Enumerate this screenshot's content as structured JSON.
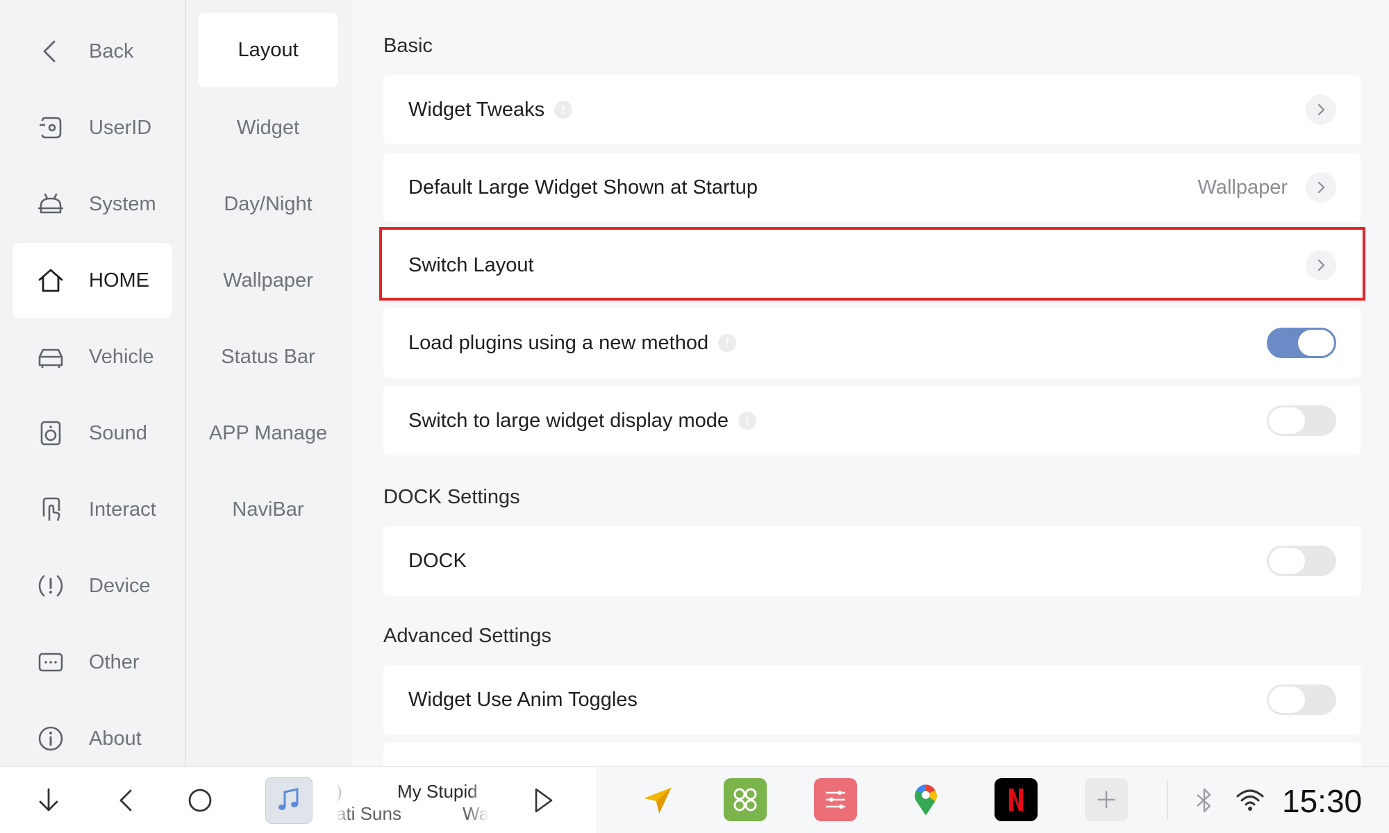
{
  "nav": {
    "items": [
      {
        "label": "Back",
        "icon": "chevron-left-icon"
      },
      {
        "label": "UserID",
        "icon": "user-id-icon"
      },
      {
        "label": "System",
        "icon": "android-icon"
      },
      {
        "label": "HOME",
        "icon": "home-icon",
        "active": true
      },
      {
        "label": "Vehicle",
        "icon": "car-icon"
      },
      {
        "label": "Sound",
        "icon": "speaker-icon"
      },
      {
        "label": "Interact",
        "icon": "touch-icon"
      },
      {
        "label": "Device",
        "icon": "alert-icon"
      },
      {
        "label": "Other",
        "icon": "more-icon"
      },
      {
        "label": "About",
        "icon": "info-icon"
      }
    ]
  },
  "subnav": {
    "items": [
      {
        "label": "Layout",
        "active": true
      },
      {
        "label": "Widget"
      },
      {
        "label": "Day/Night"
      },
      {
        "label": "Wallpaper"
      },
      {
        "label": "Status Bar"
      },
      {
        "label": "APP Manage"
      },
      {
        "label": "NaviBar"
      }
    ]
  },
  "content": {
    "basic_title": "Basic",
    "rows": {
      "widget_tweaks": {
        "label": "Widget Tweaks",
        "info": "!"
      },
      "default_large_widget": {
        "label": "Default Large Widget Shown at Startup",
        "value": "Wallpaper"
      },
      "switch_layout": {
        "label": "Switch Layout"
      },
      "load_plugins": {
        "label": "Load plugins using a new method",
        "info": "!",
        "toggle": true
      },
      "large_widget_mode": {
        "label": "Switch to large widget display mode",
        "info": "!",
        "toggle": false
      }
    },
    "dock_title": "DOCK Settings",
    "dock_row": {
      "label": "DOCK",
      "toggle": false
    },
    "advanced_title": "Advanced Settings",
    "anim_row": {
      "label": "Widget Use Anim Toggles",
      "toggle": false
    }
  },
  "bottombar": {
    "media": {
      "line1": "My Stupid",
      "line2": "ati Suns",
      "line2b": "Wa",
      "line1prefix": ")"
    },
    "clock": "15:30",
    "apps": [
      "navigation-arrow-icon",
      "apps-grid-icon",
      "equalizer-icon",
      "maps-pin-icon",
      "netflix-icon",
      "add-icon"
    ],
    "colors": {
      "grid_app": "#7ab44a",
      "eq_app": "#ec6f78",
      "netflix_bg": "#000000",
      "netflix_red": "#e50914",
      "accent": "#6a8bc6"
    }
  }
}
